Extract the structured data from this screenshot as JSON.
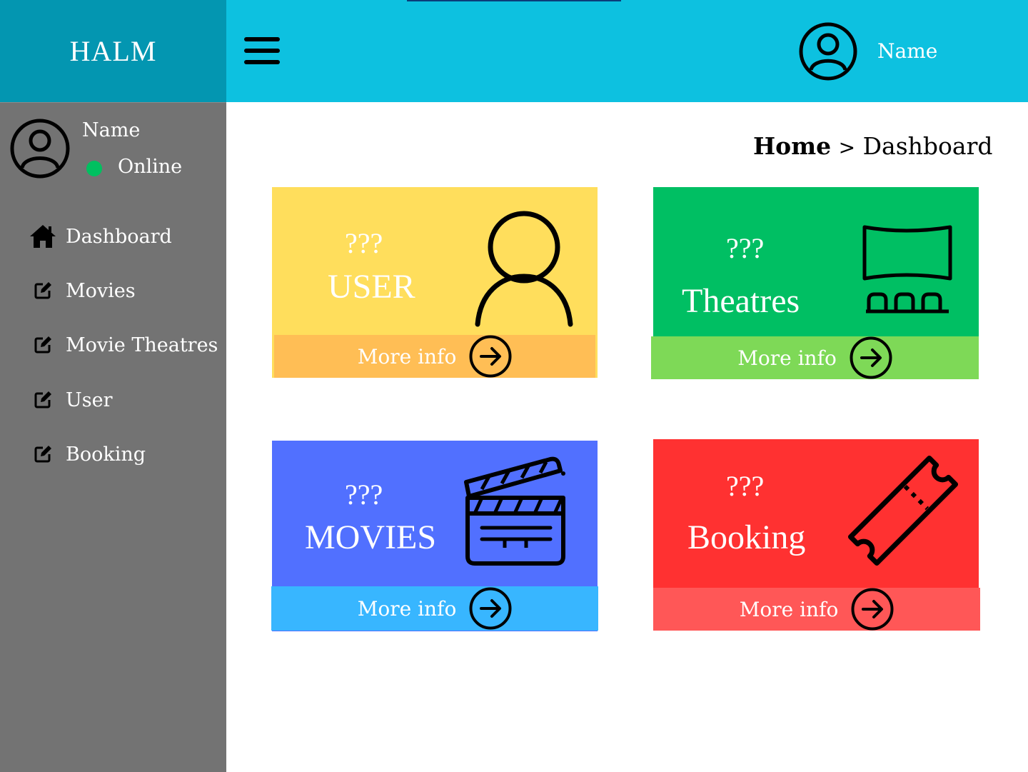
{
  "app": {
    "brand": "HALM"
  },
  "header": {
    "user_name": "Name"
  },
  "sidebar": {
    "user_name": "Name",
    "status": "Online",
    "items": [
      {
        "label": "Dashboard",
        "icon": "home-icon"
      },
      {
        "label": "Movies",
        "icon": "edit-icon"
      },
      {
        "label": "Movie Theatres",
        "icon": "edit-icon"
      },
      {
        "label": "User",
        "icon": "edit-icon"
      },
      {
        "label": "Booking",
        "icon": "edit-icon"
      }
    ]
  },
  "breadcrumb": {
    "home": "Home",
    "separator": ">",
    "current": "Dashboard"
  },
  "cards": [
    {
      "count": "???",
      "title": "USER",
      "more": "More info",
      "icon": "user-icon",
      "color": "#ffde5c",
      "footer_color": "#ffbe55"
    },
    {
      "count": "???",
      "title": "Theatres",
      "more": "More info",
      "icon": "theatre-icon",
      "color": "#00bf63",
      "footer_color": "#7ed957"
    },
    {
      "count": "???",
      "title": "MOVIES",
      "more": "More info",
      "icon": "clapperboard-icon",
      "color": "#5170ff",
      "footer_color": "#38b6ff"
    },
    {
      "count": "???",
      "title": "Booking",
      "more": "More info",
      "icon": "ticket-icon",
      "color": "#ff3131",
      "footer_color": "#ff5757"
    }
  ]
}
